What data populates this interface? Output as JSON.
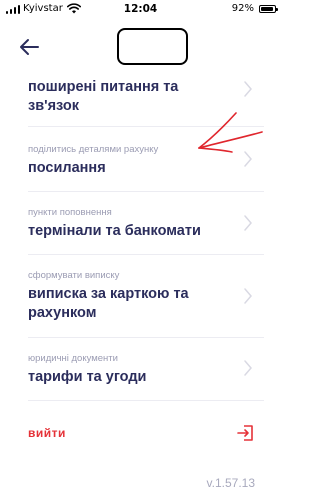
{
  "status_bar": {
    "carrier": "Kyivstar",
    "time": "12:04",
    "battery": "92%",
    "battery_level": 0.92
  },
  "menu": [
    {
      "label": "",
      "title": "поширені питання та зв'язок"
    },
    {
      "label": "поділитись деталями рахунку",
      "title": "посилання"
    },
    {
      "label": "пункти поповнення",
      "title": "термінали та банкомати"
    },
    {
      "label": "сформувати виписку",
      "title": "виписка за карткою та рахунком"
    },
    {
      "label": "юридичні документи",
      "title": "тарифи та угоди"
    }
  ],
  "logout_label": "вийти",
  "version": "v.1.57.13",
  "colors": {
    "accent": "#e53238",
    "text": "#2b2d5c",
    "muted": "#9b9cb3"
  },
  "icons": {
    "back": "arrow-left-icon",
    "chevron": "chevron-right-icon",
    "logout": "logout-icon"
  }
}
